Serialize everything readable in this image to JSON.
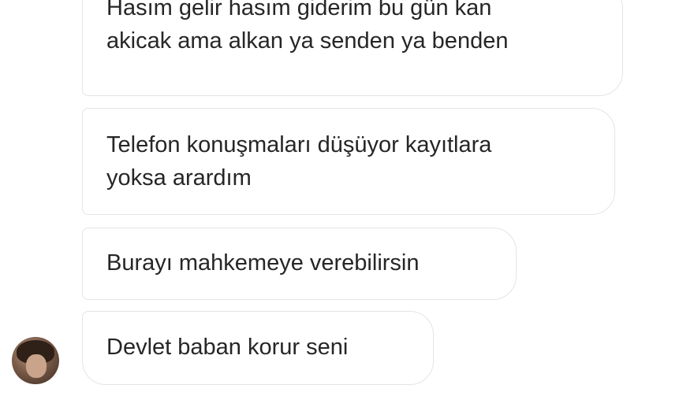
{
  "messages": [
    {
      "lines": [
        "Hasım gelir hasım giderim bu gün kan",
        "akicak ama alkan ya senden ya benden"
      ]
    },
    {
      "lines": [
        "Telefon konuşmaları düşüyor kayıtlara",
        "yoksa arardım"
      ]
    },
    {
      "lines": [
        "Burayı mahkemeye verebilirsin"
      ]
    },
    {
      "lines": [
        "Devlet baban korur seni"
      ]
    }
  ],
  "sender": {
    "avatar_icon": "profile-photo"
  },
  "colors": {
    "bubble_border": "#e4e4e4",
    "text": "#262626",
    "background": "#ffffff"
  }
}
